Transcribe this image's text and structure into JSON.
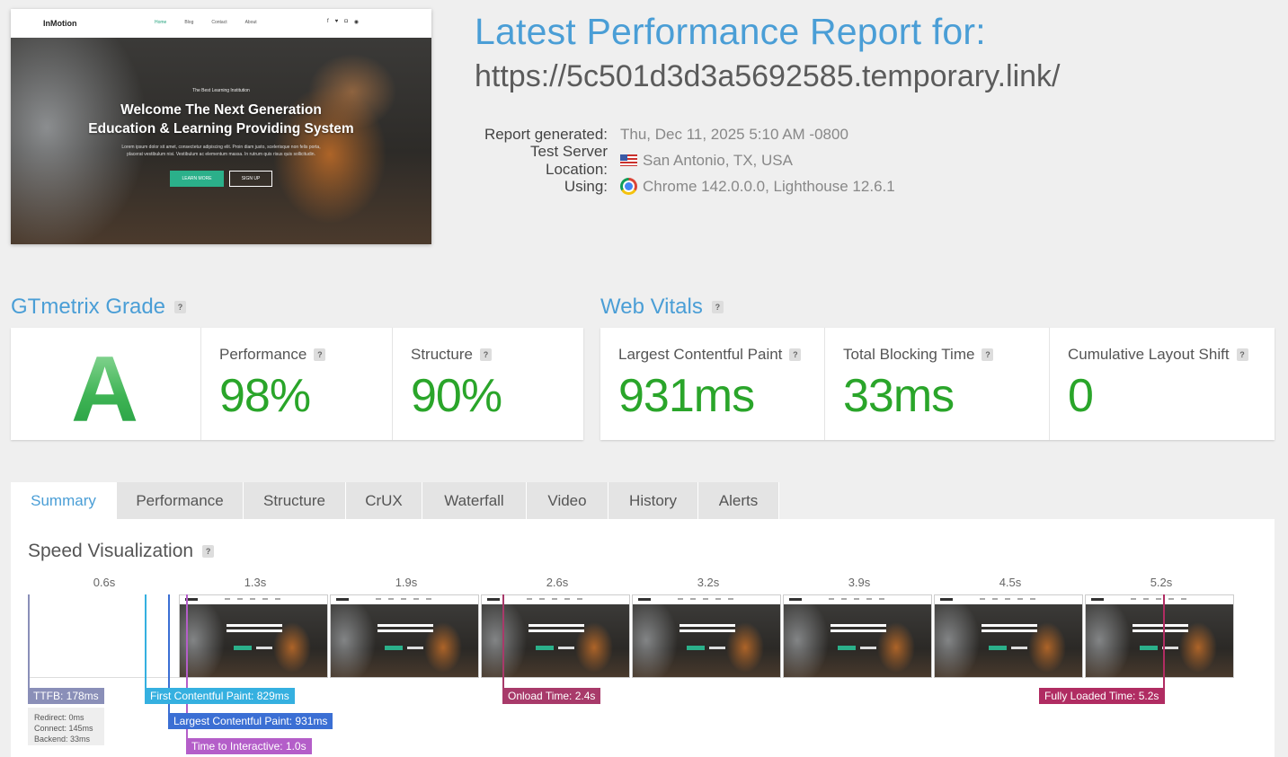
{
  "thumbnail": {
    "logo": "InMotion",
    "nav": [
      "Home",
      "Blog",
      "Contact",
      "About"
    ],
    "social_icons": [
      "facebook-icon",
      "twitter-icon",
      "instagram-icon",
      "pinterest-icon"
    ],
    "kicker": "The Best Learning Institution",
    "headline_line1": "Welcome The Next Generation",
    "headline_line2": "Education & Learning Providing System",
    "subtext": "Lorem ipsum dolor sit amet, consectetur adipiscing elit. Proin diam justo, scelerisque non felis porta, placerat vestibulum nisi. Vestibulum ac elementum massa. In rutrum quis risus quis sollicitudin.",
    "btn_primary": "LEARN MORE",
    "btn_secondary": "SIGN UP"
  },
  "header": {
    "title": "Latest Performance Report for:",
    "url": "https://5c501d3d3a5692585.temporary.link/",
    "report_generated_label": "Report generated:",
    "report_generated_value": "Thu, Dec 11, 2025 5:10 AM -0800",
    "server_location_label": "Test Server Location:",
    "server_location_value": "San Antonio, TX, USA",
    "using_label": "Using:",
    "using_value": "Chrome 142.0.0.0, Lighthouse 12.6.1"
  },
  "grade": {
    "heading": "GTmetrix Grade",
    "letter": "A",
    "performance_label": "Performance",
    "performance_value": "98%",
    "structure_label": "Structure",
    "structure_value": "90%"
  },
  "vitals": {
    "heading": "Web Vitals",
    "lcp_label": "Largest Contentful Paint",
    "lcp_value": "931ms",
    "tbt_label": "Total Blocking Time",
    "tbt_value": "33ms",
    "cls_label": "Cumulative Layout Shift",
    "cls_value": "0"
  },
  "tabs": [
    "Summary",
    "Performance",
    "Structure",
    "CrUX",
    "Waterfall",
    "Video",
    "History",
    "Alerts"
  ],
  "active_tab": "Summary",
  "speed": {
    "heading": "Speed Visualization",
    "ticks": [
      "0.6s",
      "1.3s",
      "1.9s",
      "2.6s",
      "3.2s",
      "3.9s",
      "4.5s",
      "5.2s"
    ],
    "ttfb": "TTFB: 178ms",
    "redirect": "Redirect: 0ms",
    "connect": "Connect: 145ms",
    "backend": "Backend: 33ms",
    "fcp": "First Contentful Paint: 829ms",
    "lcp": "Largest Contentful Paint: 931ms",
    "tti": "Time to Interactive: 1.0s",
    "onload": "Onload Time: 2.4s",
    "fully_loaded": "Fully Loaded Time: 5.2s"
  },
  "colors": {
    "accent": "#4a9ed6",
    "grade_green": "#2aa52a",
    "ttfb": "#8a8fb8",
    "fcp": "#35b0e0",
    "lcp": "#3b6fd4",
    "tti": "#b45ec9",
    "onload": "#a83a6a",
    "fully_loaded": "#b02c62"
  }
}
